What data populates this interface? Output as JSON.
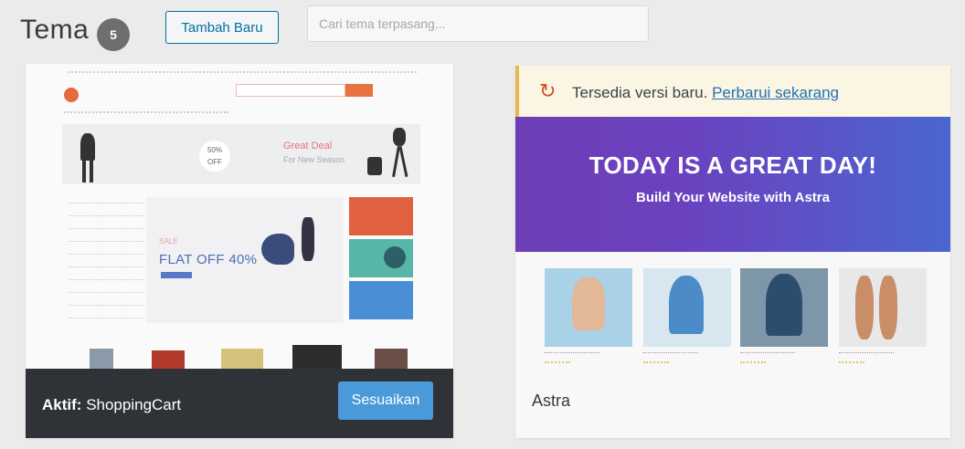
{
  "header": {
    "title": "Tema",
    "count": "5",
    "add_new_label": "Tambah Baru",
    "search_placeholder": "Cari tema terpasang..."
  },
  "themes": [
    {
      "name": "ShoppingCart",
      "active": true,
      "active_prefix": "Aktif:",
      "customize_label": "Sesuaikan",
      "preview": {
        "hero_sale": "50% OFF",
        "hero_title": "Great Deal",
        "hero_sub": "For New Season",
        "promo_small": "SALE",
        "promo_text": "FLAT OFF 40%"
      }
    },
    {
      "name": "Astra",
      "active": false,
      "update_notice": {
        "text": "Tersedia versi baru.",
        "link_label": "Perbarui sekarang"
      },
      "preview": {
        "headline": "TODAY IS A GREAT DAY!",
        "subheadline": "Build Your Website with Astra"
      }
    }
  ],
  "colors": {
    "background": "#ebebeb",
    "active_bar": "#2f3338",
    "customize_button": "#4a9ad9",
    "primary_link": "#0071a1",
    "astra_gradient_start": "#6d3fb6",
    "astra_gradient_end": "#4b66cf",
    "update_notice_bg": "#fbf6e4"
  }
}
